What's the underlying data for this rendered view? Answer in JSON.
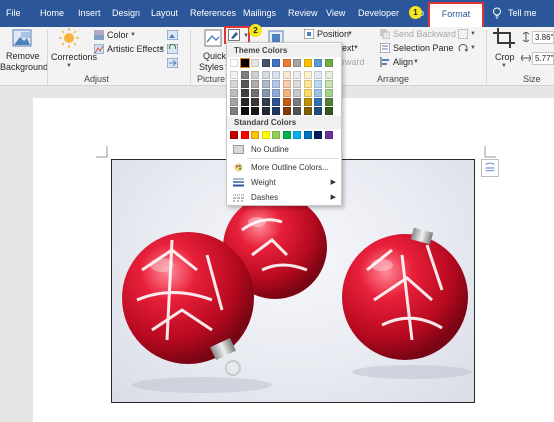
{
  "tabs": [
    "File",
    "Home",
    "Insert",
    "Design",
    "Layout",
    "References",
    "Mailings",
    "Review",
    "View",
    "Developer",
    "p",
    "Format",
    "Tell me"
  ],
  "callouts": [
    "1",
    "2"
  ],
  "ribbon": {
    "remove_background": [
      "Remove",
      "Background"
    ],
    "corrections": "Corrections",
    "color": "Color",
    "artistic_effects": "Artistic Effects",
    "group_adjust": "Adjust",
    "quick_styles": [
      "Quick",
      "Styles"
    ],
    "group_picture_styles": "Picture St",
    "position": "Position",
    "wrap_text": "ext",
    "bring_forward": "rward",
    "send_backward": "Send Backward",
    "selection_pane": "Selection Pane",
    "align": "Align",
    "group_arrange": "Arrange",
    "crop": "Crop",
    "height": "3.86\"",
    "width": "5.77\"",
    "group_size": "Size"
  },
  "menu": {
    "theme_colors_heading": "Theme Colors",
    "standard_colors_heading": "Standard Colors",
    "theme_top_row": [
      "#ffffff",
      "#000000",
      "#e7e6e6",
      "#44546a",
      "#4472c4",
      "#ed7d31",
      "#a5a5a5",
      "#ffc000",
      "#5b9bd5",
      "#70ad47"
    ],
    "theme_shades": [
      [
        "#f2f2f2",
        "#7f7f7f",
        "#d0cece",
        "#d6dce4",
        "#d9e2f3",
        "#fbe5d5",
        "#ededed",
        "#fff2cc",
        "#deebf6",
        "#e2efd9"
      ],
      [
        "#d8d8d8",
        "#595959",
        "#aeabab",
        "#adb9ca",
        "#b4c6e7",
        "#f7cbac",
        "#dbdbdb",
        "#fee599",
        "#bdd7ee",
        "#c5e0b3"
      ],
      [
        "#bfbfbf",
        "#3f3f3f",
        "#757070",
        "#8496b0",
        "#8eaadb",
        "#f4b183",
        "#c9c9c9",
        "#ffd965",
        "#9cc3e5",
        "#a8d08d"
      ],
      [
        "#a5a5a5",
        "#262626",
        "#3a3838",
        "#323f4f",
        "#2f5496",
        "#c55a11",
        "#7b7b7b",
        "#bf9000",
        "#2e75b5",
        "#538135"
      ],
      [
        "#7f7f7f",
        "#0c0c0c",
        "#171616",
        "#222a35",
        "#1f3864",
        "#833c0b",
        "#525252",
        "#7f6000",
        "#1e4e79",
        "#375623"
      ]
    ],
    "standard_colors": [
      "#c00000",
      "#ff0000",
      "#ffc000",
      "#ffff00",
      "#92d050",
      "#00b050",
      "#00b0f0",
      "#0070c0",
      "#002060",
      "#7030a0"
    ],
    "no_outline": "No Outline",
    "more_colors": "More Outline Colors...",
    "weight": "Weight",
    "dashes": "Dashes"
  }
}
